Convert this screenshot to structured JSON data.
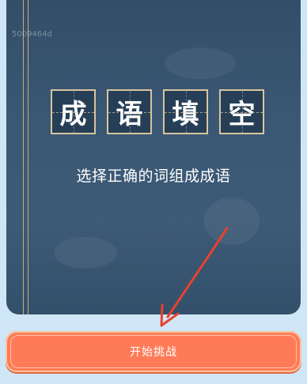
{
  "book": {
    "id_text": "5009464d",
    "title_chars": [
      "成",
      "语",
      "填",
      "空"
    ],
    "subtitle": "选择正确的词组成成语"
  },
  "start_button": {
    "label": "开始挑战"
  },
  "colors": {
    "background": "#cfe6f6",
    "book": "#3a5874",
    "border_gold": "#c7ab78",
    "button": "#ff7b57",
    "arrow": "#e8412c"
  },
  "icons": {
    "annotation": "red-arrow-icon"
  }
}
